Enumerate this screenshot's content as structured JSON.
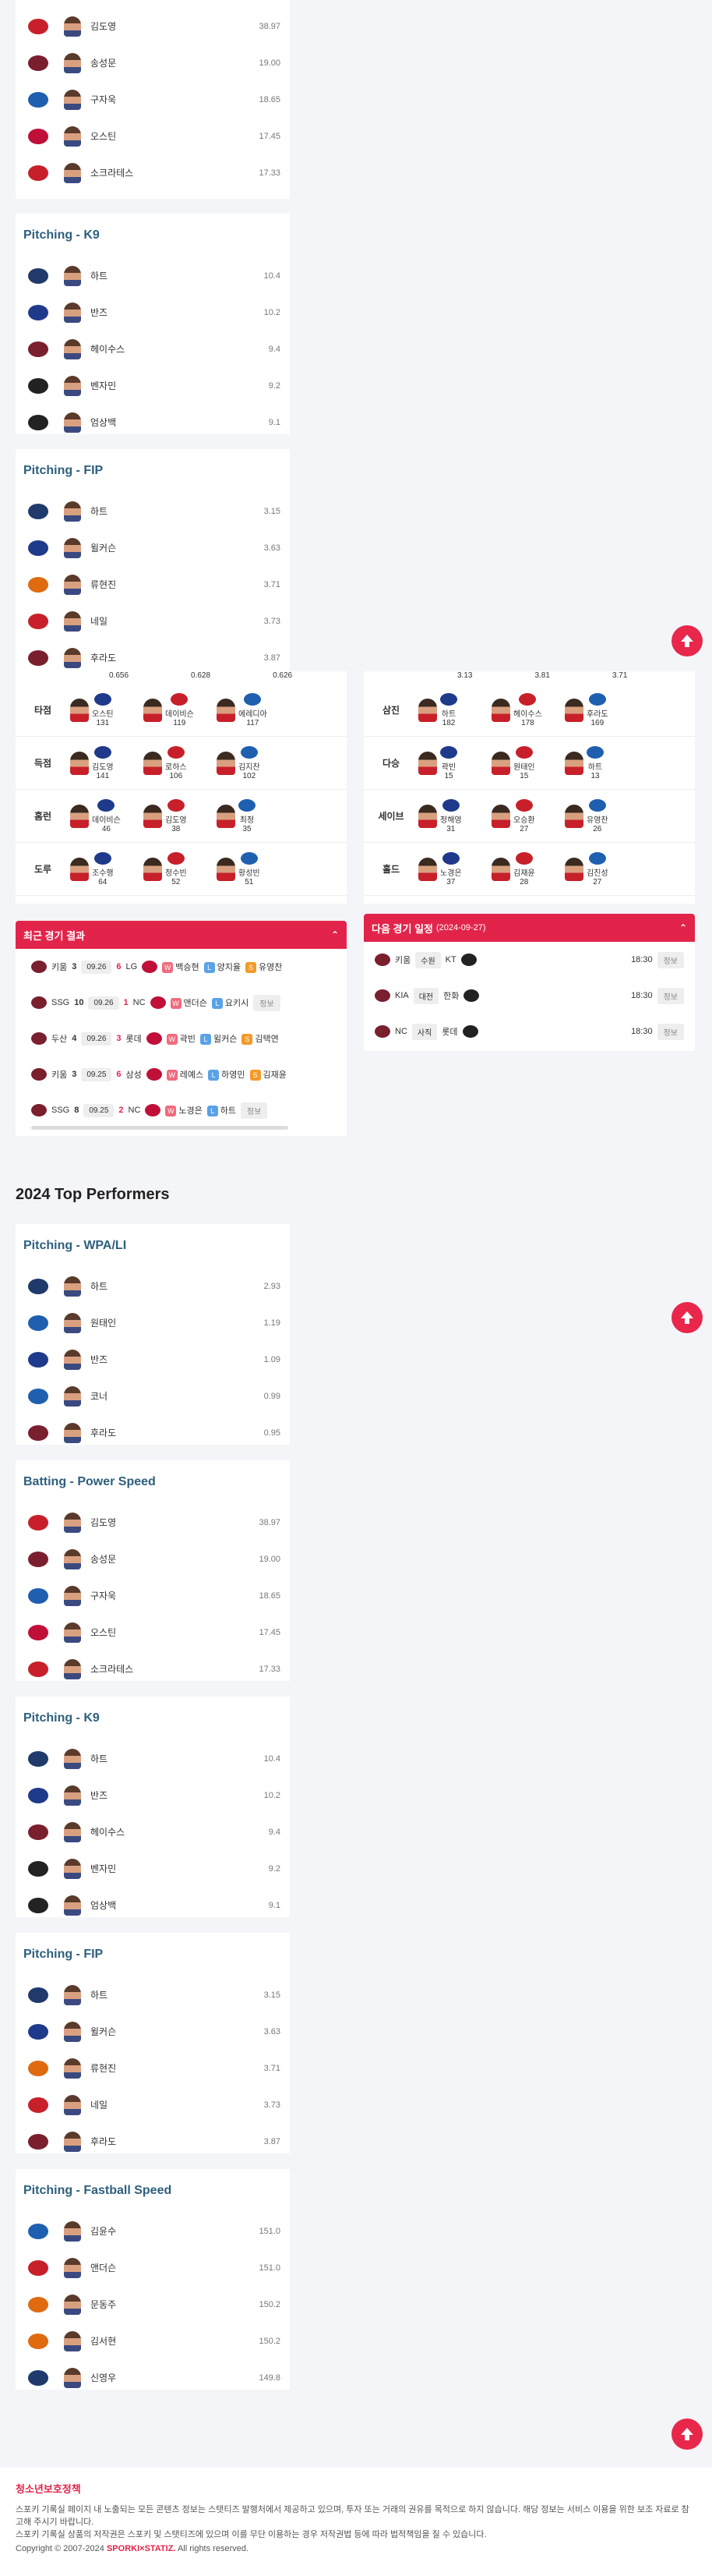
{
  "colors": {
    "accent": "#e2244a",
    "title": "#2d5f7d"
  },
  "top_cards": [
    {
      "title": "",
      "rows": [
        {
          "name": "김도영",
          "value": "38.97",
          "logo": "#c8202a"
        },
        {
          "name": "송성문",
          "value": "19.00",
          "logo": "#7a1f2e"
        },
        {
          "name": "구자욱",
          "value": "18.65",
          "logo": "#1f5fb0"
        },
        {
          "name": "오스틴",
          "value": "17.45",
          "logo": "#c0103a"
        },
        {
          "name": "소크라테스",
          "value": "17.33",
          "logo": "#c8202a"
        }
      ]
    },
    {
      "title": "Pitching - K9",
      "rows": [
        {
          "name": "하트",
          "value": "10.4",
          "logo": "#1f3a6b"
        },
        {
          "name": "반즈",
          "value": "10.2",
          "logo": "#1f3a8b"
        },
        {
          "name": "헤이수스",
          "value": "9.4",
          "logo": "#7a1f2e"
        },
        {
          "name": "벤자민",
          "value": "9.2",
          "logo": "#222222"
        },
        {
          "name": "엄상백",
          "value": "9.1",
          "logo": "#222222"
        }
      ]
    },
    {
      "title": "Pitching - FIP",
      "rows": [
        {
          "name": "하트",
          "value": "3.15",
          "logo": "#1f3a6b"
        },
        {
          "name": "윌커슨",
          "value": "3.63",
          "logo": "#1f3a8b"
        },
        {
          "name": "류현진",
          "value": "3.71",
          "logo": "#e06a10"
        },
        {
          "name": "네일",
          "value": "3.73",
          "logo": "#c8202a"
        },
        {
          "name": "후라도",
          "value": "3.87",
          "logo": "#7a1f2e"
        }
      ]
    }
  ],
  "leaders_left": {
    "partial_values": [
      "0.656",
      "0.628",
      "0.626"
    ],
    "rows": [
      {
        "cat": "타점",
        "cells": [
          {
            "name": "오스틴",
            "value": "131"
          },
          {
            "name": "데이비슨",
            "value": "119"
          },
          {
            "name": "에레디아",
            "value": "117"
          }
        ]
      },
      {
        "cat": "득점",
        "cells": [
          {
            "name": "김도영",
            "value": "141"
          },
          {
            "name": "로하스",
            "value": "106"
          },
          {
            "name": "김지찬",
            "value": "102"
          }
        ]
      },
      {
        "cat": "홈런",
        "cells": [
          {
            "name": "데이비슨",
            "value": "46"
          },
          {
            "name": "김도영",
            "value": "38"
          },
          {
            "name": "최정",
            "value": "35"
          }
        ]
      },
      {
        "cat": "도루",
        "cells": [
          {
            "name": "조수행",
            "value": "64"
          },
          {
            "name": "정수빈",
            "value": "52"
          },
          {
            "name": "황성빈",
            "value": "51"
          }
        ]
      }
    ]
  },
  "leaders_right": {
    "partial_values": [
      "3.13",
      "3.81",
      "3.71"
    ],
    "rows": [
      {
        "cat": "삼진",
        "cells": [
          {
            "name": "하트",
            "value": "182"
          },
          {
            "name": "헤이수스",
            "value": "178"
          },
          {
            "name": "후라도",
            "value": "169"
          }
        ]
      },
      {
        "cat": "다승",
        "cells": [
          {
            "name": "곽빈",
            "value": "15"
          },
          {
            "name": "원태인",
            "value": "15"
          },
          {
            "name": "하트",
            "value": "13"
          }
        ]
      },
      {
        "cat": "세이브",
        "cells": [
          {
            "name": "정해영",
            "value": "31"
          },
          {
            "name": "오승환",
            "value": "27"
          },
          {
            "name": "유영찬",
            "value": "26"
          }
        ]
      },
      {
        "cat": "홀드",
        "cells": [
          {
            "name": "노경은",
            "value": "37"
          },
          {
            "name": "김재윤",
            "value": "28"
          },
          {
            "name": "김진성",
            "value": "27"
          }
        ]
      }
    ]
  },
  "recent_results": {
    "title": "최근 경기 결과",
    "rows": [
      {
        "home": "키움",
        "hs": "3",
        "date": "09.26",
        "as": "6",
        "away": "LG",
        "w": "백승현",
        "l": "양지율",
        "s": "유영찬",
        "info": ""
      },
      {
        "home": "SSG",
        "hs": "10",
        "date": "09.26",
        "as": "1",
        "away": "NC",
        "w": "앤더슨",
        "l": "요키시",
        "s": "",
        "info": "정보"
      },
      {
        "home": "두산",
        "hs": "4",
        "date": "09.26",
        "as": "3",
        "away": "롯데",
        "w": "곽빈",
        "l": "윌커슨",
        "s": "김택연",
        "info": ""
      },
      {
        "home": "키움",
        "hs": "3",
        "date": "09.25",
        "as": "6",
        "away": "삼성",
        "w": "레예스",
        "l": "하영민",
        "s": "김재윤",
        "info": ""
      },
      {
        "home": "SSG",
        "hs": "8",
        "date": "09.25",
        "as": "2",
        "away": "NC",
        "w": "노경은",
        "l": "하트",
        "s": "",
        "info": "정보"
      }
    ]
  },
  "next_games": {
    "title": "다음 경기 일정",
    "date": "(2024-09-27)",
    "rows": [
      {
        "home": "키움",
        "stadium": "수원",
        "away": "KT",
        "time": "18:30",
        "info": "정보"
      },
      {
        "home": "KIA",
        "stadium": "대전",
        "away": "한화",
        "time": "18:30",
        "info": "정보"
      },
      {
        "home": "NC",
        "stadium": "사직",
        "away": "롯데",
        "time": "18:30",
        "info": "정보"
      }
    ]
  },
  "section_title": "2024 Top Performers",
  "bottom_cards": [
    {
      "title": "Pitching - WPA/LI",
      "rows": [
        {
          "name": "하트",
          "value": "2.93",
          "logo": "#1f3a6b"
        },
        {
          "name": "원태인",
          "value": "1.19",
          "logo": "#1f5fb0"
        },
        {
          "name": "반즈",
          "value": "1.09",
          "logo": "#1f3a8b"
        },
        {
          "name": "코너",
          "value": "0.99",
          "logo": "#1f5fb0"
        },
        {
          "name": "후라도",
          "value": "0.95",
          "logo": "#7a1f2e"
        }
      ]
    },
    {
      "title": "Batting - Power Speed",
      "rows": [
        {
          "name": "김도영",
          "value": "38.97",
          "logo": "#c8202a"
        },
        {
          "name": "송성문",
          "value": "19.00",
          "logo": "#7a1f2e"
        },
        {
          "name": "구자욱",
          "value": "18.65",
          "logo": "#1f5fb0"
        },
        {
          "name": "오스틴",
          "value": "17.45",
          "logo": "#c0103a"
        },
        {
          "name": "소크라테스",
          "value": "17.33",
          "logo": "#c8202a"
        }
      ]
    },
    {
      "title": "Pitching - K9",
      "rows": [
        {
          "name": "하트",
          "value": "10.4",
          "logo": "#1f3a6b"
        },
        {
          "name": "반즈",
          "value": "10.2",
          "logo": "#1f3a8b"
        },
        {
          "name": "헤이수스",
          "value": "9.4",
          "logo": "#7a1f2e"
        },
        {
          "name": "벤자민",
          "value": "9.2",
          "logo": "#222222"
        },
        {
          "name": "엄상백",
          "value": "9.1",
          "logo": "#222222"
        }
      ]
    },
    {
      "title": "Pitching - FIP",
      "rows": [
        {
          "name": "하트",
          "value": "3.15",
          "logo": "#1f3a6b"
        },
        {
          "name": "윌커슨",
          "value": "3.63",
          "logo": "#1f3a8b"
        },
        {
          "name": "류현진",
          "value": "3.71",
          "logo": "#e06a10"
        },
        {
          "name": "네일",
          "value": "3.73",
          "logo": "#c8202a"
        },
        {
          "name": "후라도",
          "value": "3.87",
          "logo": "#7a1f2e"
        }
      ]
    },
    {
      "title": "Pitching - Fastball Speed",
      "rows": [
        {
          "name": "김윤수",
          "value": "151.0",
          "logo": "#1f5fb0"
        },
        {
          "name": "앤더슨",
          "value": "151.0",
          "logo": "#c8202a"
        },
        {
          "name": "문동주",
          "value": "150.2",
          "logo": "#e06a10"
        },
        {
          "name": "김서현",
          "value": "150.2",
          "logo": "#e06a10"
        },
        {
          "name": "신영우",
          "value": "149.8",
          "logo": "#1f3a6b"
        }
      ]
    }
  ],
  "footer": {
    "title": "청소년보호정책",
    "line1": "스포키 기록실 페이지 내 노출되는 모든 콘텐츠 정보는 스탯티즈 발행처에서 제공하고 있으며, 투자 또는 거래의 권유를 목적으로 하지 않습니다. 해당 정보는 서비스 이용을 위한 보조 자료로 참고해 주시기 바랍니다.",
    "line2": "스포키 기록실 상품의 저작권은 스포키 및 스탯티즈에 있으며 이를 무단 이용하는 경우 저작권법 등에 따라 법적책임을 질 수 있습니다.",
    "copyright": "Copyright © 2007-2024",
    "brand": "SPORKI×STATIZ.",
    "rights": "All rights reserved."
  }
}
